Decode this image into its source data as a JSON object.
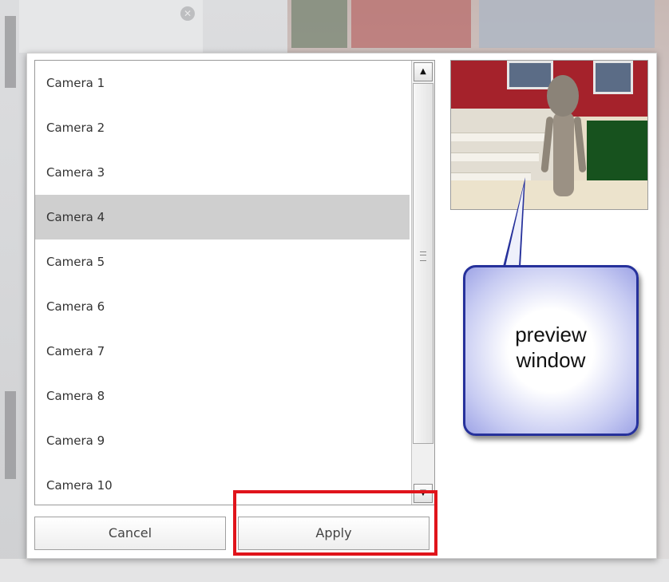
{
  "camera_list": {
    "items": [
      {
        "label": "Camera 1"
      },
      {
        "label": "Camera 2"
      },
      {
        "label": "Camera 3"
      },
      {
        "label": "Camera 4",
        "selected": true
      },
      {
        "label": "Camera 5"
      },
      {
        "label": "Camera 6"
      },
      {
        "label": "Camera 7"
      },
      {
        "label": "Camera 8"
      },
      {
        "label": "Camera 9"
      },
      {
        "label": "Camera 10"
      }
    ]
  },
  "buttons": {
    "cancel_label": "Cancel",
    "apply_label": "Apply"
  },
  "callout": {
    "line1": "preview",
    "line2": "window"
  },
  "colors": {
    "highlight_border": "#e0141b",
    "callout_border": "#26319b",
    "selected_row": "#cfcfcf"
  },
  "icons": {
    "scroll_up": "arrow-up-icon",
    "scroll_down": "arrow-down-icon",
    "background_close": "close-icon"
  }
}
